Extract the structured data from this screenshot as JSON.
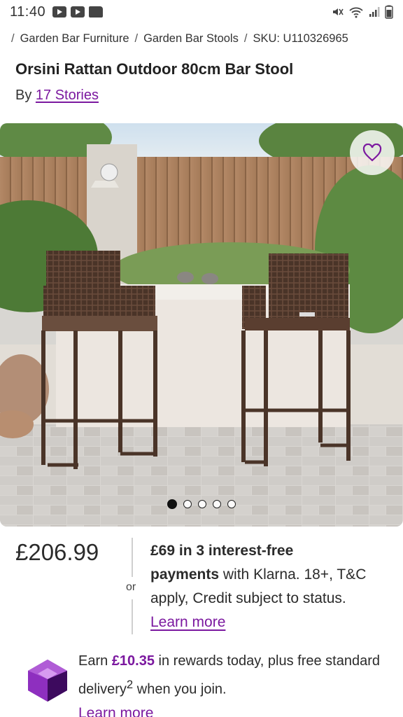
{
  "status_bar": {
    "time": "11:40"
  },
  "breadcrumb": {
    "items": [
      "Garden Bar Furniture",
      "Garden Bar Stools"
    ],
    "sku": "SKU: U110326965"
  },
  "product": {
    "title": "Orsini Rattan Outdoor 80cm Bar Stool",
    "by_prefix": "By",
    "brand": "17 Stories"
  },
  "gallery": {
    "image_count": 5,
    "active_index": 0
  },
  "pricing": {
    "price": "£206.99",
    "or_label": "or",
    "klarna_amount": "£69 in 3 interest-free",
    "klarna_payments": "payments",
    "klarna_text": "with Klarna. 18+, T&C apply, Credit subject to status.",
    "learn_more": "Learn more"
  },
  "rewards": {
    "earn_prefix": "Earn",
    "amount": "£10.35",
    "text_1": "in rewards today, plus free standard delivery",
    "superscript": "2",
    "text_2": "when you join.",
    "learn_more": "Learn more"
  },
  "colors": {
    "accent": "#7b189f",
    "text": "#2b2b2b"
  }
}
